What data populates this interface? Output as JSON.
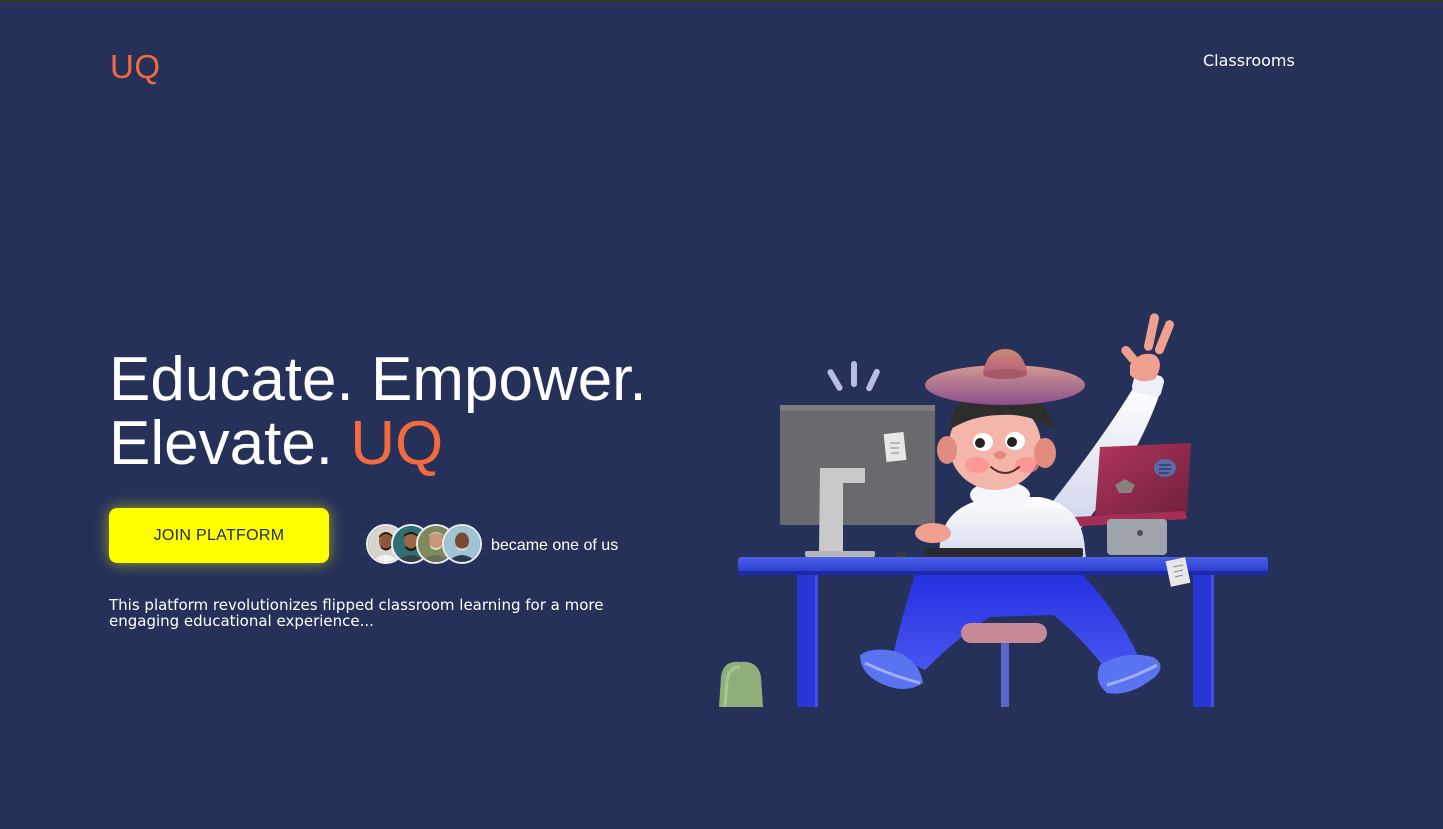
{
  "header": {
    "logo": "UQ",
    "nav": {
      "classrooms": "Classrooms"
    }
  },
  "hero": {
    "title_line1": "Educate. Empower.",
    "title_line2_prefix": "Elevate.",
    "title_line2_accent": "UQ",
    "cta_label": "JOIN PLATFORM",
    "community_text": "became one of us",
    "description": "This platform revolutionizes flipped classroom learning for a more engaging educational experience..."
  },
  "colors": {
    "background": "#26315a",
    "accent": "#f26a3d",
    "cta": "#ffff00",
    "text": "#ffffff"
  }
}
